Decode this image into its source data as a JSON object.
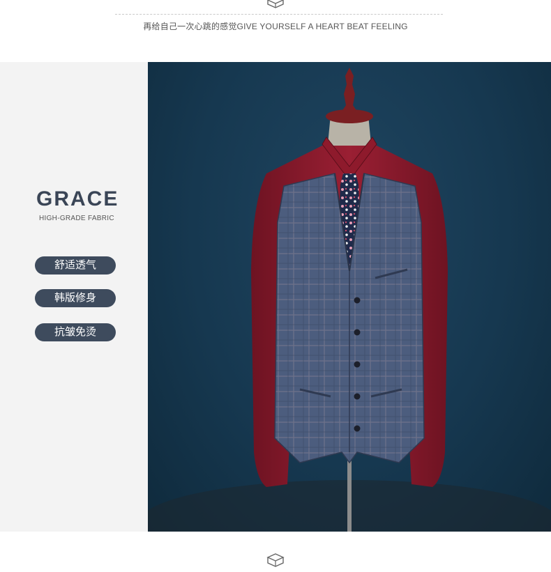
{
  "header": {
    "slogan": "再给自己一次心跳的感觉GIVE YOURSELF A HEART BEAT FEELING",
    "icon": "box-icon"
  },
  "sidebar": {
    "brand": "GRACE",
    "sub_brand": "HIGH-GRADE FABRIC",
    "features": [
      {
        "label": "舒适透气"
      },
      {
        "label": "韩版修身"
      },
      {
        "label": "抗皱免烫"
      }
    ]
  },
  "product_image": {
    "subject": "vest-on-mannequin",
    "colors": {
      "background": "#163850",
      "shirt": "#8e1a2c",
      "vest": "#4a5a7a",
      "mannequin_head": "#7a1f22"
    }
  },
  "footer": {
    "icon": "box-icon"
  },
  "colors": {
    "pill_bg": "#3e4b5d",
    "brand_text": "#3a4556",
    "panel_bg": "#f3f3f3"
  }
}
